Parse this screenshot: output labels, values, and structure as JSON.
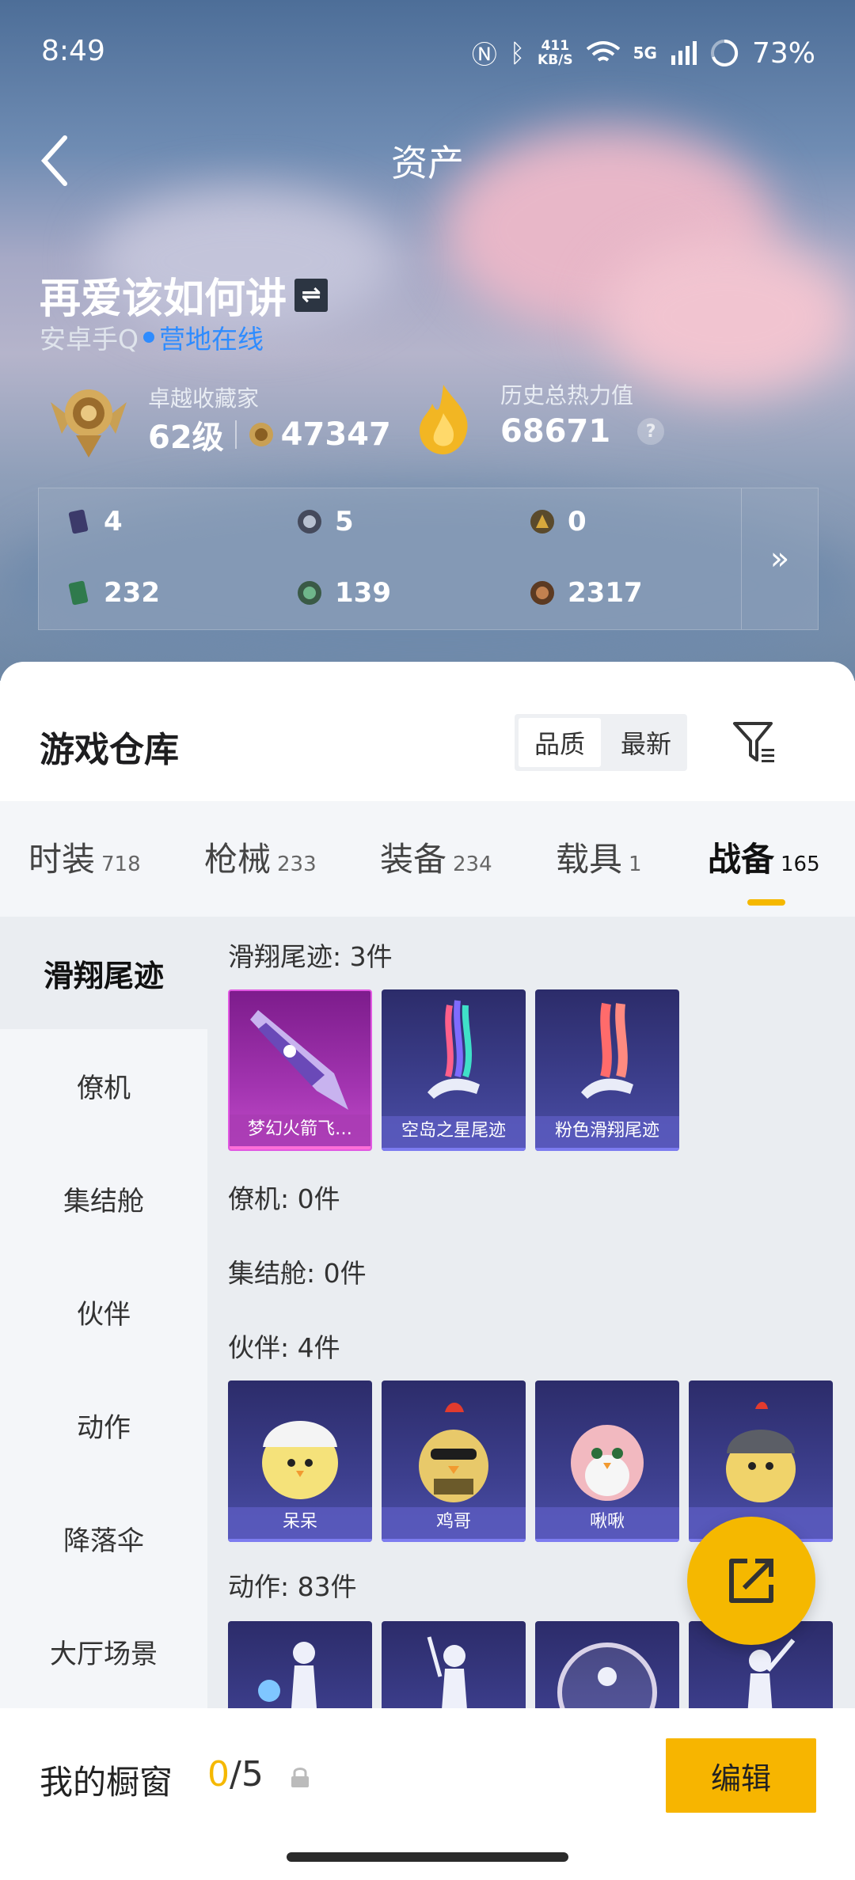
{
  "status_bar": {
    "time": "8:49",
    "speed_top": "411",
    "speed_bottom": "KB/S",
    "network": "5G",
    "battery": "73%"
  },
  "header": {
    "title": "资产",
    "player_name": "再爱该如何讲",
    "swap_glyph": "⇌",
    "platform": "安卓手Q",
    "camp_status": "营地在线"
  },
  "rank": {
    "label": "卓越收藏家",
    "level": "62级",
    "points": "47347"
  },
  "heat": {
    "label": "历史总热力值",
    "value": "68671",
    "help": "?"
  },
  "stats": [
    {
      "icon": "card-icon",
      "value": "4"
    },
    {
      "icon": "silver-coin-icon",
      "value": "5"
    },
    {
      "icon": "gold-coin-icon",
      "value": "0"
    },
    {
      "icon": "green-card-icon",
      "value": "232"
    },
    {
      "icon": "green-coin-icon",
      "value": "139"
    },
    {
      "icon": "bronze-coin-icon",
      "value": "2317"
    }
  ],
  "stats_more": "»",
  "warehouse": {
    "title": "游戏仓库",
    "sort_options": [
      "品质",
      "最新"
    ],
    "sort_selected": "品质"
  },
  "tabs": [
    {
      "label": "时装",
      "count": "718"
    },
    {
      "label": "枪械",
      "count": "233"
    },
    {
      "label": "装备",
      "count": "234"
    },
    {
      "label": "载具",
      "count": "1"
    },
    {
      "label": "战备",
      "count": "165"
    }
  ],
  "side_menu": [
    "滑翔尾迹",
    "僚机",
    "集结舱",
    "伙伴",
    "动作",
    "降落伞",
    "大厅场景"
  ],
  "sections": {
    "glide_trail": {
      "label": "滑翔尾迹: 3件",
      "items": [
        "梦幻火箭飞…",
        "空岛之星尾迹",
        "粉色滑翔尾迹"
      ]
    },
    "wingman": {
      "label": "僚机: 0件"
    },
    "rally_pod": {
      "label": "集结舱: 0件"
    },
    "companion": {
      "label": "伙伴: 4件",
      "items": [
        "呆呆",
        "鸡哥",
        "啾啾",
        ""
      ]
    },
    "emote": {
      "label": "动作: 83件"
    }
  },
  "showcase": {
    "label": "我的橱窗",
    "current": "0",
    "total": "/5",
    "edit_label": "编辑"
  },
  "colors": {
    "accent": "#f5b800",
    "online_blue": "#2f8cff",
    "card_purple": "#3d3f8e",
    "card_pink": "#a234b0"
  }
}
